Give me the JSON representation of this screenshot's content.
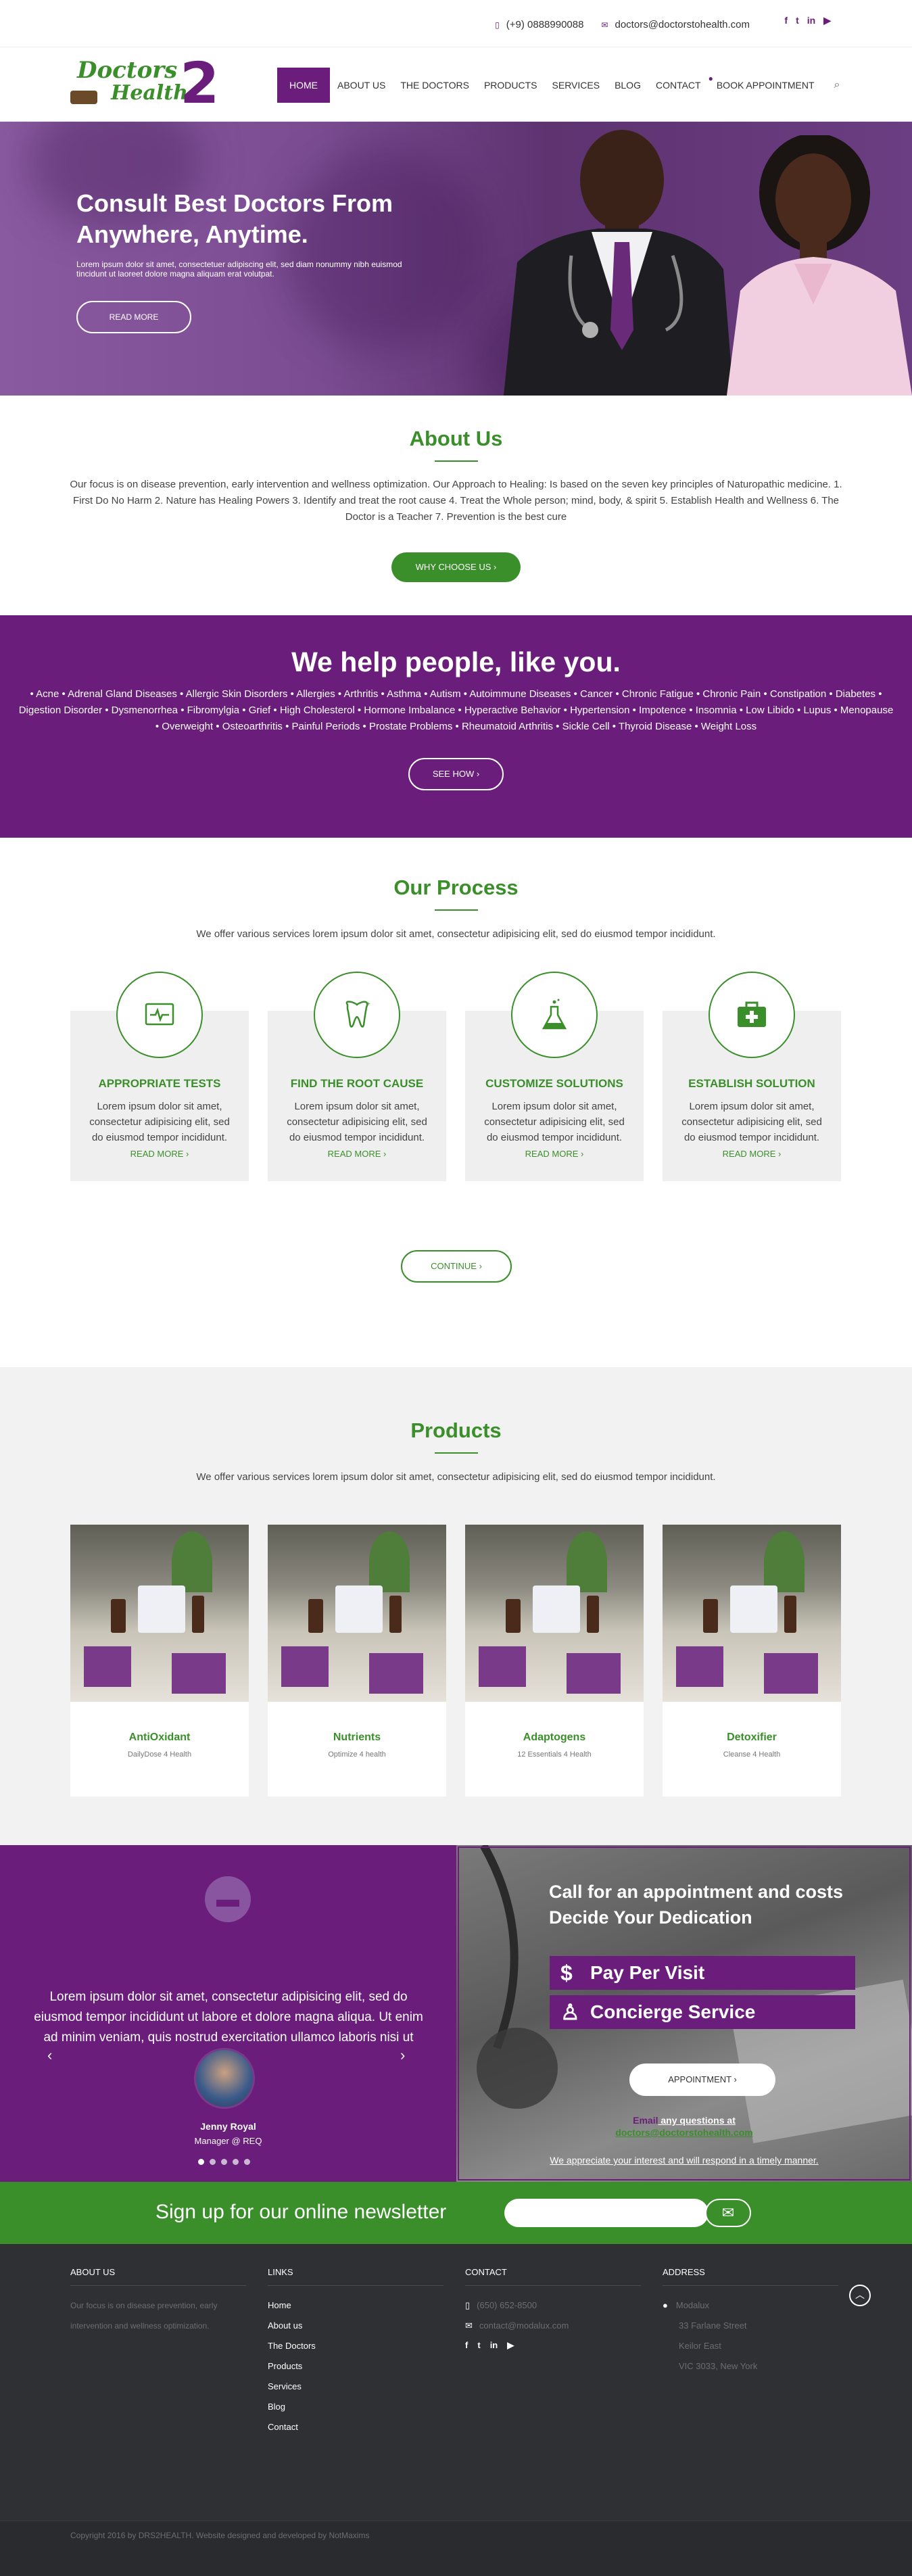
{
  "topbar": {
    "phone": "(+9) 0888990088",
    "email": "doctors@doctorstohealth.com",
    "social": [
      "facebook-icon",
      "twitter-icon",
      "linkedin-icon",
      "youtube-icon"
    ],
    "social_glyphs": [
      "f",
      "t",
      "in",
      "▶"
    ]
  },
  "logo": {
    "line1": "Doctors",
    "line2": "Health",
    "num": "2"
  },
  "nav": {
    "items": [
      "HOME",
      "ABOUT US",
      "THE DOCTORS",
      "PRODUCTS",
      "SERVICES",
      "BLOG",
      "CONTACT",
      "BOOK APPOINTMENT"
    ]
  },
  "hero": {
    "title": "Consult Best Doctors From Anywhere, Anytime.",
    "text": "Lorem ipsum dolor sit amet, consectetuer adipiscing elit, sed diam nonummy nibh euismod tincidunt ut laoreet dolore magna aliquam erat volutpat.",
    "button": "READ MORE"
  },
  "about": {
    "title": "About Us",
    "text": "Our focus is on disease prevention, early intervention and wellness optimization. Our Approach to Healing: Is based on the seven key principles of Naturopathic medicine. 1. First Do No Harm 2. Nature has Healing Powers 3. Identify and treat the root cause 4. Treat the Whole person; mind, body, & spirit 5. Establish Health and Wellness 6. The Doctor is a Teacher 7. Prevention is the best cure",
    "button": "WHY CHOOSE US ›"
  },
  "help": {
    "title": "We help people, like you.",
    "text": "• Acne • Adrenal Gland Diseases • Allergic Skin Disorders • Allergies • Arthritis • Asthma • Autism • Autoimmune Diseases • Cancer • Chronic Fatigue • Chronic Pain • Constipation • Diabetes • Digestion Disorder • Dysmenorrhea • Fibromylgia • Grief • High Cholesterol • Hormone Imbalance • Hyperactive Behavior • Hypertension • Impotence • Insomnia • Low Libido • Lupus • Menopause • Overweight • Osteoarthritis • Painful Periods • Prostate Problems • Rheumatoid Arthritis • Sickle Cell • Thyroid Disease • Weight Loss",
    "button": "SEE HOW ›"
  },
  "process": {
    "title": "Our Process",
    "subtitle": "We offer various services lorem ipsum dolor sit amet, consectetur adipisicing elit, sed do eiusmod tempor incididunt.",
    "cards": [
      {
        "icon": "monitor-pulse-icon",
        "glyph": "⎍",
        "title": "APPROPRIATE TESTS",
        "text": "Lorem ipsum dolor sit amet, consectetur adipisicing elit, sed do eiusmod tempor incididunt.",
        "link": "READ MORE ›"
      },
      {
        "icon": "tooth-icon",
        "glyph": "♡",
        "title": "FIND THE ROOT CAUSE",
        "text": "Lorem ipsum dolor sit amet, consectetur adipisicing elit, sed do eiusmod tempor incididunt.",
        "link": "READ MORE ›"
      },
      {
        "icon": "flask-icon",
        "glyph": "⚗",
        "title": "CUSTOMIZE SOLUTIONS",
        "text": "Lorem ipsum dolor sit amet, consectetur adipisicing elit, sed do eiusmod tempor incididunt.",
        "link": "READ MORE ›"
      },
      {
        "icon": "medkit-icon",
        "glyph": "✚",
        "title": "ESTABLISH SOLUTION",
        "text": "Lorem ipsum dolor sit amet, consectetur adipisicing elit, sed do eiusmod tempor incididunt.",
        "link": "READ MORE ›"
      }
    ],
    "button": "CONTINUE ›"
  },
  "products": {
    "title": "Products",
    "subtitle": "We offer various services lorem ipsum dolor sit amet, consectetur adipisicing elit, sed do eiusmod tempor incididunt.",
    "items": [
      {
        "name": "AntiOxidant",
        "tag": "DailyDose 4 Health"
      },
      {
        "name": "Nutrients",
        "tag": "Optimize 4 health"
      },
      {
        "name": "Adaptogens",
        "tag": "12 Essentials 4 Health"
      },
      {
        "name": "Detoxifier",
        "tag": "Cleanse 4 Health"
      }
    ]
  },
  "testimonial": {
    "quote": "Lorem ipsum dolor sit amet, consectetur adipisicing elit, sed do eiusmod tempor incididunt ut labore et dolore magna aliqua. Ut enim ad minim veniam, quis nostrud exercitation ullamco laboris nisi ut aliquip.",
    "name": "Jenny Royal",
    "role": "Manager @ REQ",
    "dots": 5,
    "active_dot": 1
  },
  "appointment": {
    "title": "Call for an appointment and costs Decide Your Dedication",
    "pay": "Pay Per Visit",
    "concierge": "Concierge Service",
    "button": "APPOINTMENT ›",
    "q_prefix": "Email",
    "q_text": " any questions at",
    "email": "doctors@doctorstohealth.com",
    "note": "We appreciate your interest and will respond in a timely manner."
  },
  "newsletter": {
    "label": "Sign up for our online newsletter",
    "placeholder": ""
  },
  "footer": {
    "about_title": "ABOUT US",
    "about_text": "Our focus is on disease prevention, early intervention and wellness optimization.",
    "links_title": "LINKS",
    "links": [
      "Home",
      "About us",
      "The Doctors",
      "Products",
      "Services",
      "Blog",
      "Contact"
    ],
    "contact_title": "CONTACT",
    "phone": "(650) 652-8500",
    "email": "contact@modalux.com",
    "address_title": "ADDRESS",
    "address": [
      "Modalux",
      "33 Farlane Street",
      "Keilor East",
      "VIC 3033, New York"
    ],
    "copyright": "Copyright 2016 by DRS2HEALTH. Website designed and developed by NotMaxims"
  },
  "colors": {
    "purple": "#6a1d7a",
    "green": "#3a8f2a",
    "footer": "#2f3033"
  }
}
